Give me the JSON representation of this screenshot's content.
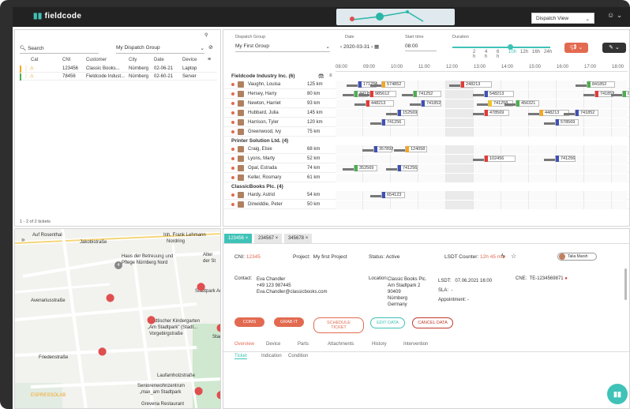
{
  "app": {
    "logo": "fieldcode",
    "view_select": "Dispatch View",
    "user_glyph": "☺ ⌄"
  },
  "left_top": {
    "search_label": "Search",
    "group_select": "My Dispatch Group",
    "footer": "1 - 2 of 2 tickets",
    "columns": [
      "Cat",
      "CNI",
      "Customer",
      "City",
      "Date",
      "Device"
    ],
    "rows": [
      {
        "color": "#f5a623",
        "cni": "123456",
        "customer": "Classic Books...",
        "city": "Nürnberg",
        "date": "02-06-21",
        "device": "Laptop"
      },
      {
        "color": "#4caf50",
        "cni": "78456",
        "customer": "Fieldcode Indust...",
        "city": "Nürnberg",
        "date": "02-60-21",
        "device": "Server"
      }
    ]
  },
  "dispatch": {
    "group_label": "Dispatch Group",
    "group_value": "My First Group",
    "date_label": "Date",
    "date_value": "2020-03-31",
    "start_label": "Start time",
    "start_value": "08:00",
    "duration_label": "Duration",
    "duration_ticks": [
      "2\nh",
      "4\nh",
      "6\nh",
      "10h",
      "12h",
      "16h",
      "24h"
    ],
    "times": [
      "08:00",
      "09:00",
      "10:00",
      "11:00",
      "12:00",
      "13:00",
      "14:00",
      "15:00",
      "16:00",
      "17:00",
      "18:00"
    ],
    "groups": [
      {
        "name": "Fieldcode Industry Inc. (6)",
        "rows": [
          {
            "name": "Vaughn, Louisa",
            "dist": "125 km"
          },
          {
            "name": "Hersey, Harry",
            "dist": "80 km"
          },
          {
            "name": "Newton, Harriet",
            "dist": "93 km"
          },
          {
            "name": "Hubbard, Julia",
            "dist": "145 km"
          },
          {
            "name": "Harrison, Tyler",
            "dist": "120 km"
          },
          {
            "name": "Greenwood, Ivy",
            "dist": "75 km"
          }
        ]
      },
      {
        "name": "Printer Solution Ltd. (4)",
        "rows": [
          {
            "name": "Craig, Elsie",
            "dist": "68 km"
          },
          {
            "name": "Lyons, Marty",
            "dist": "52 km"
          },
          {
            "name": "Opal, Estrada",
            "dist": "74 km"
          },
          {
            "name": "Keller, Rosmary",
            "dist": "61 km"
          }
        ]
      },
      {
        "name": "ClassicBooks Plc. (4)",
        "rows": [
          {
            "name": "Hardy, Astrid",
            "dist": "54 km"
          },
          {
            "name": "Dinwiddie, Peter",
            "dist": "50 km"
          }
        ]
      }
    ]
  },
  "map": {
    "labels": [
      "Auf Rosenthal",
      "Jakobistraße",
      "Inh. Frank Lehmann",
      "Nordring",
      "Haus der Betreuung und",
      "Pflege Nürnberg Nord",
      "Alter",
      "der St",
      "Stadtpark Ac",
      "Städtischer Kindergarten",
      "„Am Stadtpark\" (Stadt...",
      "Vorgebirgstraße",
      "Stadtpark A",
      "Friedenstraße",
      "Seniorenwohnzentrum",
      "„max_am Stadtpark",
      "ESPRESSOLAB",
      "Grevena Restaurant",
      "Avenariusstraße",
      "Laufamholzstraße"
    ],
    "badge": "4"
  },
  "ticket": {
    "tabs": [
      "123456",
      "234567",
      "345678"
    ],
    "cni_label": "CNI:",
    "cni_value": "12345",
    "project_label": "Project:",
    "project_value": "My first Project",
    "status_label": "Status:",
    "status_value": "Active",
    "lsdt_counter_label": "LSDT Counter:",
    "lsdt_counter_value": "12h 45 min",
    "assignee": "Talia Marsh",
    "contact_label": "Contact:",
    "contact_lines": [
      "Eva Chandler",
      "+49 123 987445",
      "Eva.Chandler@classicbooks.com"
    ],
    "location_label": "Location:",
    "location_lines": [
      "Classic Books Plc.",
      "Am Stadtpark 2",
      "90409",
      "Nürnberg",
      "Germany"
    ],
    "lsdt_label": "LSDT:",
    "lsdt_value": "07.06.2021 16:00",
    "sla_label": "SLA:",
    "sla_value": "-",
    "appointment_label": "Appointment:",
    "appointment_value": "-",
    "cne_label": "CNE:",
    "cne_value": "TE-1234569871",
    "actions": [
      "COMS",
      "GRAB IT",
      "SCHEDULE TICKET",
      "EDIT DATA",
      "CANCEL DATA"
    ],
    "nav_tabs": [
      "Overview",
      "Device",
      "Parts",
      "Attachments",
      "History",
      "Intervention"
    ],
    "sub_tabs": [
      "Ticket",
      "Indication",
      "Condition"
    ]
  }
}
